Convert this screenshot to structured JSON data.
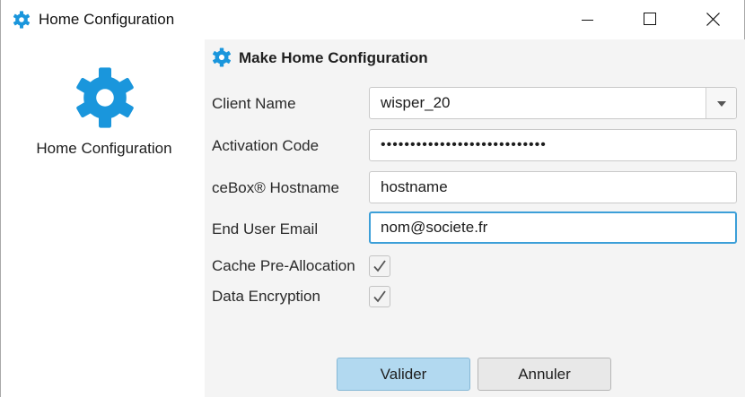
{
  "window": {
    "title": "Home Configuration",
    "title_icon": "gear-icon",
    "controls": [
      "minimize",
      "maximize",
      "close"
    ]
  },
  "sidebar": {
    "icon": "gear-icon",
    "label": "Home Configuration"
  },
  "form": {
    "heading": "Make Home Configuration",
    "heading_icon": "gear-icon",
    "fields": {
      "client_name": {
        "label": "Client Name",
        "value": "wisper_20"
      },
      "activation_code": {
        "label": "Activation Code",
        "value": "••••••••••••••••••••••••••••"
      },
      "hostname": {
        "label": "ceBox® Hostname",
        "value": "hostname"
      },
      "email": {
        "label": "End User Email",
        "value": "nom@societe.fr"
      }
    },
    "checkboxes": {
      "cache": {
        "label": "Cache Pre-Allocation",
        "checked": true
      },
      "encryption": {
        "label": "Data Encryption",
        "checked": true
      }
    },
    "buttons": {
      "ok": "Valider",
      "cancel": "Annuler"
    }
  },
  "colors": {
    "accent": "#1a96dc",
    "focus_border": "#3c9fd8",
    "primary_button": "#b2d9f0",
    "panel_background": "#f4f4f4"
  }
}
